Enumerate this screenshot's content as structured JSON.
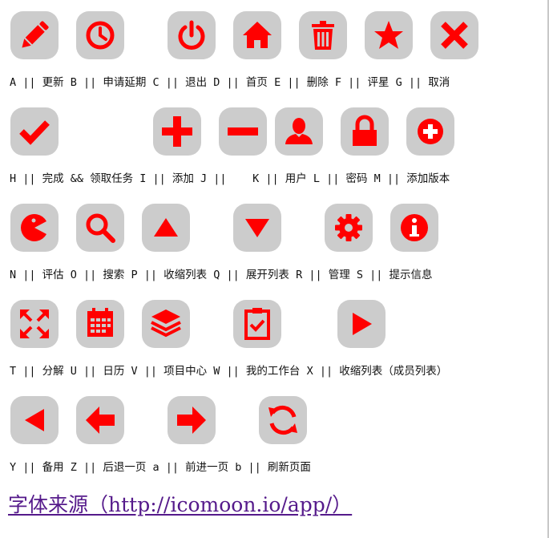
{
  "accent_color": "#ff0000",
  "button_bg": "#cccccc",
  "rows": [
    {
      "caption": "A || 更新 B || 申请延期 C || 退出 D || 首页 E || 删除 F || 评星 G || 取消",
      "icons": [
        "pencil-icon",
        "clock-icon",
        "power-icon",
        "home-icon",
        "trash-icon",
        "star-icon",
        "close-icon"
      ]
    },
    {
      "caption": "H || 完成 && 领取任务 I || 添加 J ||    K || 用户 L || 密码 M || 添加版本",
      "icons": [
        "check-icon",
        "plus-icon",
        "minus-icon",
        "user-icon",
        "lock-icon",
        "plus-circle-icon"
      ]
    },
    {
      "caption": "N || 评估 O || 搜索 P || 收缩列表 Q || 展开列表 R || 管理 S || 提示信息",
      "icons": [
        "pacman-icon",
        "search-icon",
        "triangle-up-icon",
        "triangle-down-icon",
        "gear-icon",
        "info-icon"
      ]
    },
    {
      "caption": "T || 分解 U || 日历 V || 项目中心 W || 我的工作台 X || 收缩列表（成员列表）",
      "icons": [
        "expand-arrows-icon",
        "calendar-icon",
        "layers-icon",
        "clipboard-check-icon",
        "play-icon"
      ]
    },
    {
      "caption": "Y || 备用 Z || 后退一页 a || 前进一页 b || 刷新页面",
      "icons": [
        "triangle-left-icon",
        "arrow-left-icon",
        "arrow-right-icon",
        "refresh-icon"
      ]
    }
  ],
  "source_link": "字体来源（http://icomoon.io/app/）"
}
